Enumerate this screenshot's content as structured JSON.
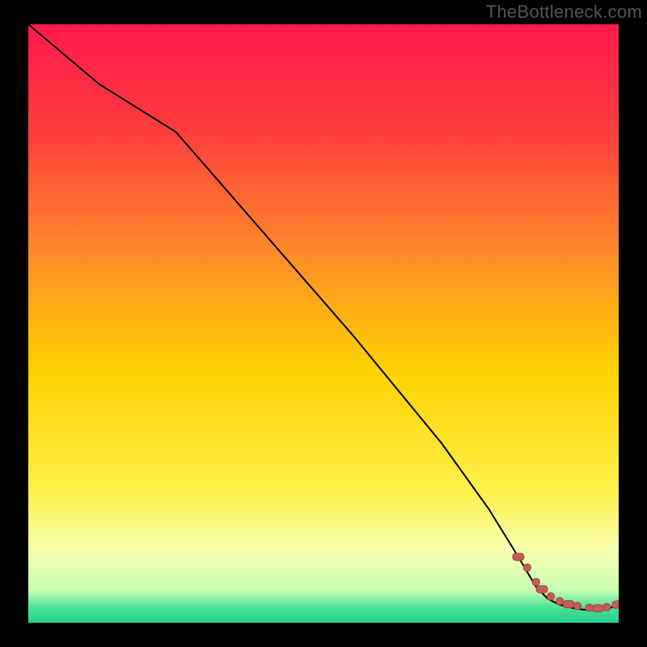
{
  "watermark": "TheBottleneck.com",
  "colors": {
    "frame": "#000000",
    "watermark": "#555555",
    "curve": "#000000",
    "marker_fill": "#c06058",
    "marker_stroke": "#a84040",
    "gradient_stops": [
      {
        "offset": 0.0,
        "color": "#ff1a4d"
      },
      {
        "offset": 0.18,
        "color": "#ff3d3d"
      },
      {
        "offset": 0.38,
        "color": "#ff8a2a"
      },
      {
        "offset": 0.58,
        "color": "#ffd200"
      },
      {
        "offset": 0.78,
        "color": "#fff04a"
      },
      {
        "offset": 0.88,
        "color": "#f7ffb0"
      },
      {
        "offset": 0.945,
        "color": "#c8ffb0"
      },
      {
        "offset": 0.975,
        "color": "#4fe09a"
      },
      {
        "offset": 1.0,
        "color": "#1fd08a"
      }
    ]
  },
  "chart_data": {
    "type": "line",
    "title": "",
    "xlabel": "",
    "ylabel": "",
    "xlim": [
      0,
      100
    ],
    "ylim": [
      0,
      100
    ],
    "series": [
      {
        "name": "bottleneck-curve",
        "x": [
          0,
          12,
          25,
          40,
          55,
          70,
          78,
          83,
          86,
          88,
          90,
          92,
          94,
          96,
          98,
          100
        ],
        "y": [
          100,
          90,
          82,
          65,
          48,
          30,
          19,
          11,
          6,
          4,
          3,
          2.5,
          2.2,
          2.1,
          2.3,
          3
        ]
      }
    ],
    "markers": {
      "name": "dashed-tail",
      "x": [
        83,
        84.5,
        86,
        87,
        88.5,
        90,
        91.5,
        93,
        95,
        96.5,
        98,
        99.5
      ],
      "y": [
        11,
        9.2,
        6.8,
        5.6,
        4.4,
        3.6,
        3.1,
        2.8,
        2.5,
        2.4,
        2.6,
        3.0
      ]
    }
  }
}
